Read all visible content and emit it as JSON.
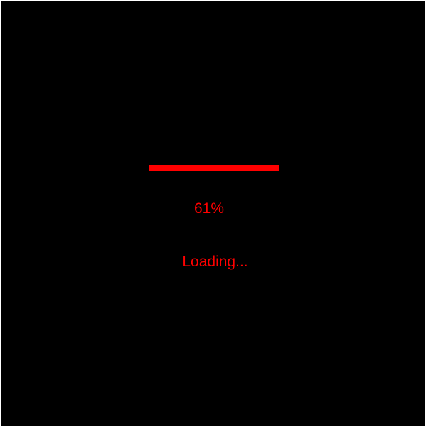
{
  "loader": {
    "percent_text": "61%",
    "status_text": "Loading...",
    "progress_fraction": 1.0
  },
  "colors": {
    "background": "#000000",
    "accent": "#ff0000",
    "frame_border": "#ffffff"
  }
}
